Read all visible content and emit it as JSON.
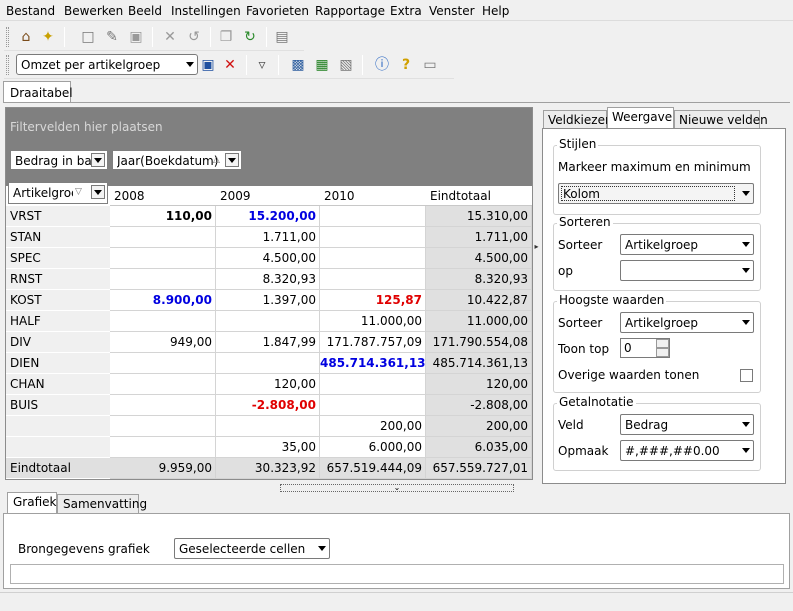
{
  "menu": [
    "Bestand",
    "Bewerken",
    "Beeld",
    "Instellingen",
    "Favorieten",
    "Rapportage",
    "Extra",
    "Venster",
    "Help"
  ],
  "toolbar": {
    "report_selector": "Omzet per artikelgroep"
  },
  "doc_tab": "Draaitabel",
  "pivot": {
    "filter_placeholder": "Filtervelden hier plaatsen",
    "data_field": "Bedrag in basis",
    "column_field": "Jaar(Boekdatum)",
    "row_field": "Artikelgroep",
    "columns": [
      "2008",
      "2009",
      "2010",
      "Eindtotaal"
    ],
    "rows": [
      {
        "label": "VRST",
        "c2008": "110,00",
        "c2009": "15.200,00",
        "c2010": "",
        "total": "15.310,00"
      },
      {
        "label": "STAN",
        "c2008": "",
        "c2009": "1.711,00",
        "c2010": "",
        "total": "1.711,00"
      },
      {
        "label": "SPEC",
        "c2008": "",
        "c2009": "4.500,00",
        "c2010": "",
        "total": "4.500,00"
      },
      {
        "label": "RNST",
        "c2008": "",
        "c2009": "8.320,93",
        "c2010": "",
        "total": "8.320,93"
      },
      {
        "label": "KOST",
        "c2008": "8.900,00",
        "c2009": "1.397,00",
        "c2010": "125,87",
        "total": "10.422,87"
      },
      {
        "label": "HALF",
        "c2008": "",
        "c2009": "",
        "c2010": "11.000,00",
        "total": "11.000,00"
      },
      {
        "label": "DIV",
        "c2008": "949,00",
        "c2009": "1.847,99",
        "c2010": "171.787.757,09",
        "total": "171.790.554,08"
      },
      {
        "label": "DIEN",
        "c2008": "",
        "c2009": "",
        "c2010": "485.714.361,13",
        "total": "485.714.361,13"
      },
      {
        "label": "CHAN",
        "c2008": "",
        "c2009": "120,00",
        "c2010": "",
        "total": "120,00"
      },
      {
        "label": "BUIS",
        "c2008": "",
        "c2009": "-2.808,00",
        "c2010": "",
        "total": "-2.808,00"
      },
      {
        "label": "",
        "c2008": "",
        "c2009": "",
        "c2010": "200,00",
        "total": "200,00"
      },
      {
        "label": "",
        "c2008": "",
        "c2009": "35,00",
        "c2010": "6.000,00",
        "total": "6.035,00"
      }
    ],
    "grand_total": {
      "label": "Eindtotaal",
      "c2008": "9.959,00",
      "c2009": "30.323,92",
      "c2010": "657.519.444,09",
      "total": "657.559.727,01"
    },
    "highlights": {
      "bold_black": [
        "0.c2008"
      ],
      "blue": [
        "0.c2009",
        "4.c2008",
        "7.c2010"
      ],
      "red": [
        "4.c2010",
        "9.c2009"
      ]
    },
    "colors": {
      "blue": "#0000e0",
      "red": "#e00000"
    }
  },
  "right_panel": {
    "tabs": [
      "Veldkiezer",
      "Weergave",
      "Nieuwe velden"
    ],
    "active_tab": "Weergave",
    "stijlen": {
      "title": "Stijlen",
      "label": "Markeer maximum en minimum",
      "value": "Kolom"
    },
    "sorteren": {
      "title": "Sorteren",
      "sort_label": "Sorteer",
      "sort_value": "Artikelgroep",
      "on_label": "op",
      "on_value": ""
    },
    "hoogste": {
      "title": "Hoogste waarden",
      "sort_label": "Sorteer",
      "sort_value": "Artikelgroep",
      "top_label": "Toon top",
      "top_value": "0",
      "others_label": "Overige waarden tonen"
    },
    "getalnotatie": {
      "title": "Getalnotatie",
      "field_label": "Veld",
      "field_value": "Bedrag",
      "format_label": "Opmaak",
      "format_value": "#,###,##0.00"
    }
  },
  "bottom": {
    "tabs": [
      "Grafiek",
      "Samenvatting"
    ],
    "source_label": "Brongegevens grafiek",
    "source_value": "Geselecteerde cellen"
  }
}
